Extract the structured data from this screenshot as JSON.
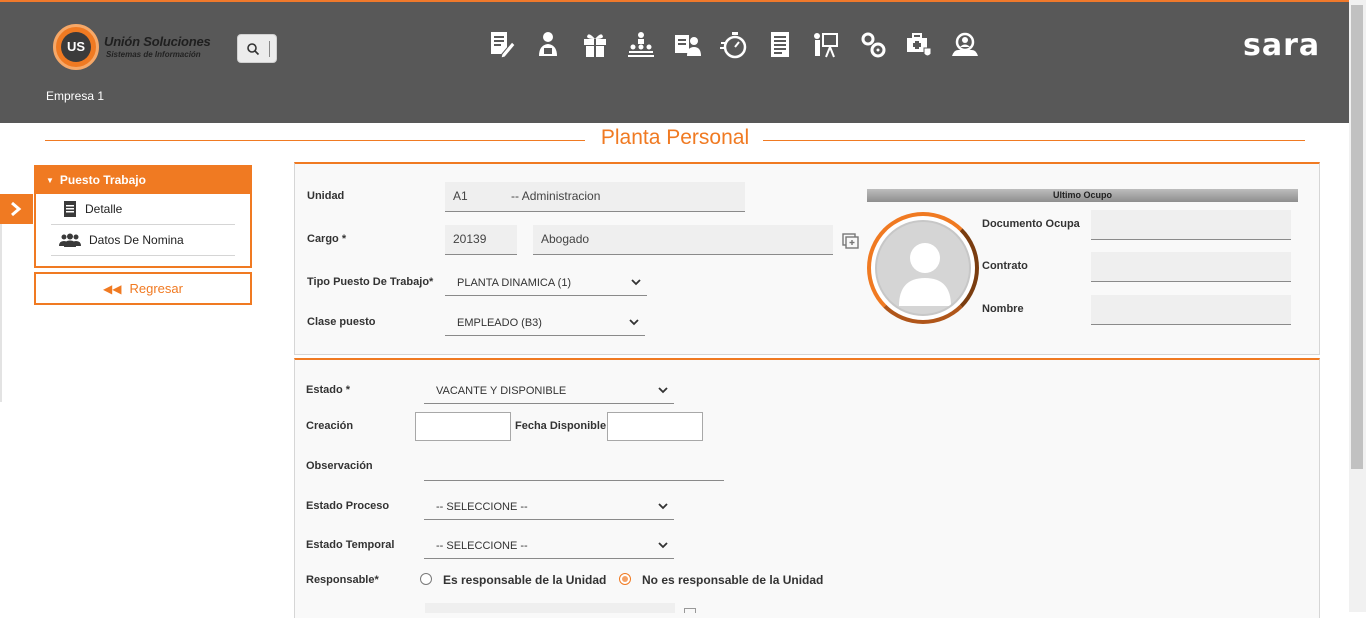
{
  "header": {
    "logo_badge": "US",
    "logo_name": "Unión Soluciones",
    "logo_subtitle": "Sistemas de Información",
    "brand": "sara",
    "company": "Empresa 1",
    "icons": [
      "document-edit-icon",
      "user-certificate-icon",
      "gift-icon",
      "org-hierarchy-icon",
      "user-card-icon",
      "stopwatch-icon",
      "document-list-icon",
      "presentation-icon",
      "gears-icon",
      "medical-case-icon",
      "user-search-icon"
    ]
  },
  "page": {
    "title": "Planta Personal"
  },
  "sidebar": {
    "header": "Puesto Trabajo",
    "items": [
      {
        "label": "Detalle",
        "icon": "document-icon"
      },
      {
        "label": "Datos De Nomina",
        "icon": "group-icon"
      }
    ],
    "back_label": "Regresar"
  },
  "form1": {
    "unidad_label": "Unidad",
    "unidad_code": "A1",
    "unidad_name": "-- Administracion",
    "cargo_label": "Cargo *",
    "cargo_code": "20139",
    "cargo_name": "Abogado",
    "tipo_label": "Tipo Puesto De Trabajo*",
    "tipo_value": "PLANTA DINAMICA (1)",
    "clase_label": "Clase puesto",
    "clase_value": "EMPLEADO (B3)"
  },
  "ultimo": {
    "title": "Ultimo Ocupo",
    "documento_label": "Documento Ocupa",
    "contrato_label": "Contrato",
    "nombre_label": "Nombre"
  },
  "form2": {
    "estado_label": "Estado *",
    "estado_value": "VACANTE Y DISPONIBLE",
    "creacion_label": "Creación",
    "fecha_label": "Fecha Disponible",
    "observacion_label": "Observación",
    "proceso_label": "Estado Proceso",
    "proceso_value": "-- SELECCIONE --",
    "temporal_label": "Estado Temporal",
    "temporal_value": "-- SELECCIONE --",
    "responsable_label": "Responsable*",
    "resp_option_yes": "Es responsable de la Unidad",
    "resp_option_no": "No es responsable de la Unidad",
    "responsable_selected": "No es responsable de la Unidad"
  },
  "colors": {
    "accent": "#f07a22",
    "header_bg": "#585858"
  }
}
